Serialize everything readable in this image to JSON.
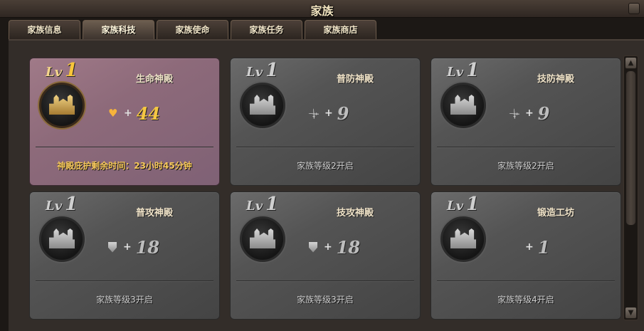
{
  "window": {
    "title": "家族"
  },
  "tabs": [
    {
      "label": "家族信息",
      "active": false
    },
    {
      "label": "家族科技",
      "active": true
    },
    {
      "label": "家族使命",
      "active": false
    },
    {
      "label": "家族任务",
      "active": false
    },
    {
      "label": "家族商店",
      "active": false
    }
  ],
  "cards": [
    {
      "level_prefix": "Lv",
      "level": "1",
      "name": "生命神殿",
      "icon": "heart-icon",
      "plus": "+",
      "value": "44",
      "status": "神殿庇护剩余时间：23小时45分钟",
      "active": true
    },
    {
      "level_prefix": "Lv",
      "level": "1",
      "name": "普防神殿",
      "icon": "sword-icon",
      "plus": "+",
      "value": "9",
      "status": "家族等级2开启",
      "active": false
    },
    {
      "level_prefix": "Lv",
      "level": "1",
      "name": "技防神殿",
      "icon": "sword-icon",
      "plus": "+",
      "value": "9",
      "status": "家族等级2开启",
      "active": false
    },
    {
      "level_prefix": "Lv",
      "level": "1",
      "name": "普攻神殿",
      "icon": "shield-icon",
      "plus": "+",
      "value": "18",
      "status": "家族等级3开启",
      "active": false
    },
    {
      "level_prefix": "Lv",
      "level": "1",
      "name": "技攻神殿",
      "icon": "shield-icon",
      "plus": "+",
      "value": "18",
      "status": "家族等级3开启",
      "active": false
    },
    {
      "level_prefix": "Lv",
      "level": "1",
      "name": "锻造工坊",
      "icon": "",
      "plus": "+",
      "value": "1",
      "status": "家族等级4开启",
      "active": false
    }
  ],
  "scrollbar": {
    "up_glyph": "▲",
    "down_glyph": "▼"
  }
}
